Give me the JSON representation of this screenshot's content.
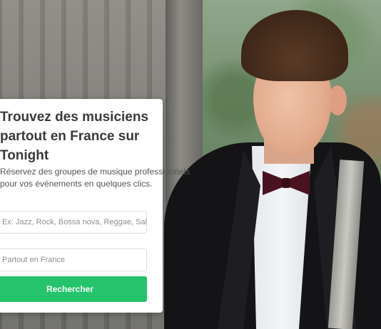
{
  "hero": {
    "title_lines": [
      "Trouvez des musiciens",
      "partout en France sur",
      "Tonight"
    ],
    "subtitle_lines": [
      "Réservez des groupes de musique professionnels",
      "pour vos événements en quelques clics."
    ]
  },
  "search": {
    "style_placeholder": "Ex: Jazz, Rock, Bossa nova, Reggae, Salsa, Ragga",
    "location_placeholder": "Partout en France",
    "submit_label": "Rechercher"
  },
  "colors": {
    "accent": "#25c36b",
    "card": "#ffffff",
    "title": "#3a3a3a"
  }
}
